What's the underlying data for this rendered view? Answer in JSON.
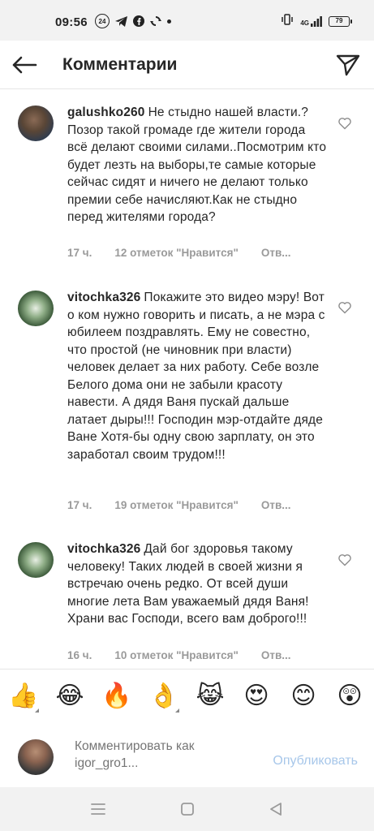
{
  "status_bar": {
    "time": "09:56",
    "badge": "24",
    "network": "4G",
    "battery": "79",
    "icons": [
      "badge-24-icon",
      "telegram-icon",
      "facebook-icon",
      "sync-icon",
      "dot-icon",
      "vibrate-icon",
      "signal-icon",
      "battery-icon"
    ]
  },
  "header": {
    "title": "Комментарии",
    "back_icon": "arrow-left-icon",
    "share_icon": "send-icon"
  },
  "comments": [
    {
      "username": "galushko260",
      "text": "Не стыдно нашей власти.?Позор такой громаде где жители города всё делают своими силами..Посмотрим кто будет лезть на выборы,те самые которые сейчас сидят и ничего не делают только премии себе начисляют.Как не стыдно перед жителями города?",
      "time": "17 ч.",
      "likes": "12 отметок \"Нравится\"",
      "reply": "Отв..."
    },
    {
      "username": "vitochka326",
      "text": "Покажите это видео мэру! Вот о ком нужно говорить и писать, а не мэра с юбилеем поздравлять. Ему не совестно, что простой (не чиновник при власти) человек делает за них работу. Себе возле Белого дома они не забыли красоту навести. А дядя Ваня пускай дальше латает дыры!!! Господин мэр-отдайте дяде Ване Хотя-бы одну свою зарплату, он это заработал своим трудом!!!",
      "time": "17 ч.",
      "likes": "19 отметок \"Нравится\"",
      "reply": "Отв..."
    },
    {
      "username": "vitochka326",
      "text": "Дай бог здоровья такому человеку! Таких людей в своей жизни я встречаю очень редко. От всей души многие лета Вам уважаемый дядя Ваня! Храни вас Господи, всего вам доброго!!!",
      "time": "16 ч.",
      "likes": "10 отметок \"Нравится\"",
      "reply": "Отв..."
    }
  ],
  "emoji_bar": [
    "👍",
    "😂",
    "🔥",
    "👌",
    "😹",
    "😍",
    "😊",
    "😲"
  ],
  "input_bar": {
    "placeholder": "Комментировать как igor_gro1...",
    "publish_label": "Опубликовать"
  },
  "nav_bar": {
    "icons": [
      "menu-icon",
      "home-square-icon",
      "back-triangle-icon"
    ]
  },
  "colors": {
    "text": "#262626",
    "meta": "#9a9a9a",
    "publish_disabled": "#a7c7ea",
    "system_bar": "#f2f2f2"
  }
}
